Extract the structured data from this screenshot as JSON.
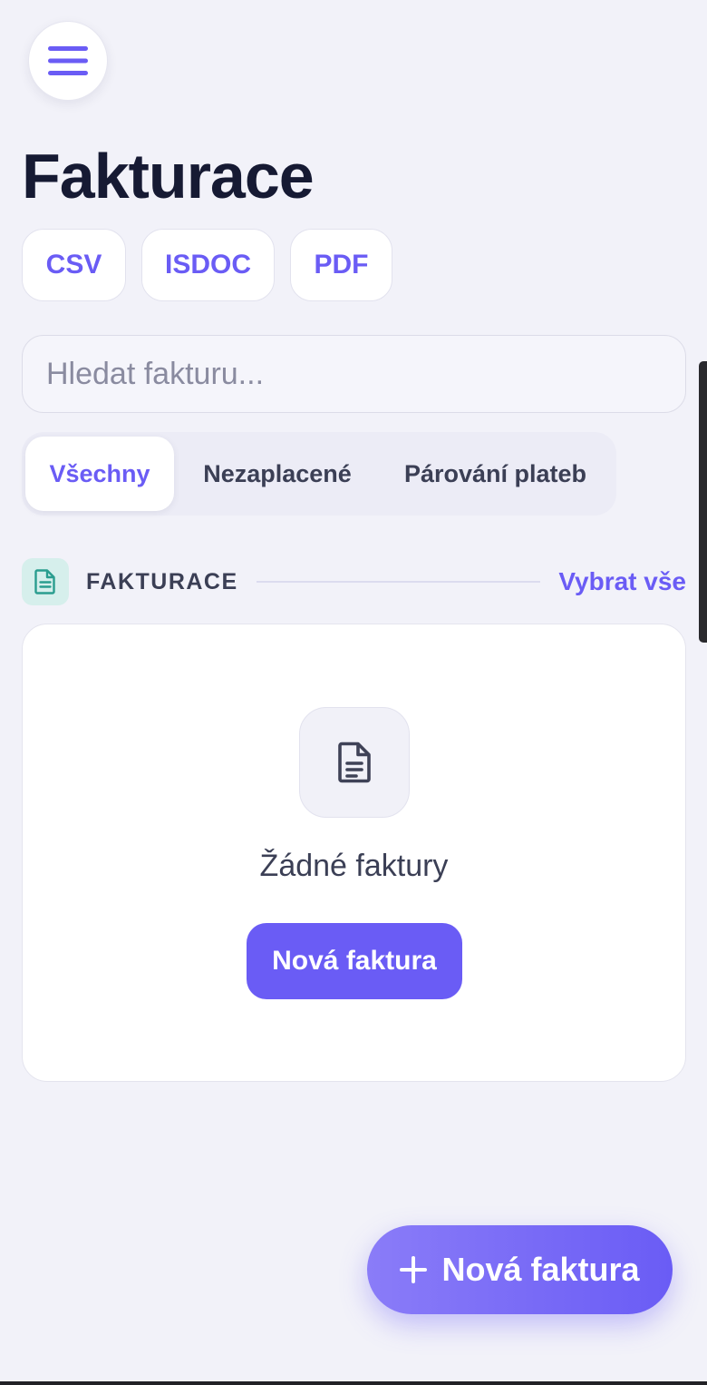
{
  "header": {
    "menu_icon": "hamburger-icon",
    "title": "Fakturace"
  },
  "export": {
    "csv_label": "CSV",
    "isdoc_label": "ISDOC",
    "pdf_label": "PDF"
  },
  "search": {
    "placeholder": "Hledat fakturu...",
    "value": ""
  },
  "tabs": [
    {
      "label": "Všechny",
      "active": true
    },
    {
      "label": "Nezaplacené",
      "active": false
    },
    {
      "label": "Párování plateb",
      "active": false
    }
  ],
  "section": {
    "icon": "document-icon",
    "title": "FAKTURACE",
    "select_all_label": "Vybrat vše"
  },
  "empty_state": {
    "icon": "document-icon",
    "message": "Žádné faktury",
    "button_label": "Nová faktura"
  },
  "fab": {
    "icon": "plus-icon",
    "label": "Nová faktura"
  },
  "colors": {
    "accent": "#6a5cf5",
    "background": "#f2f2f9",
    "section_icon_bg": "#d6efec",
    "section_icon_fg": "#2a9d8f",
    "title_text": "#161a33"
  }
}
